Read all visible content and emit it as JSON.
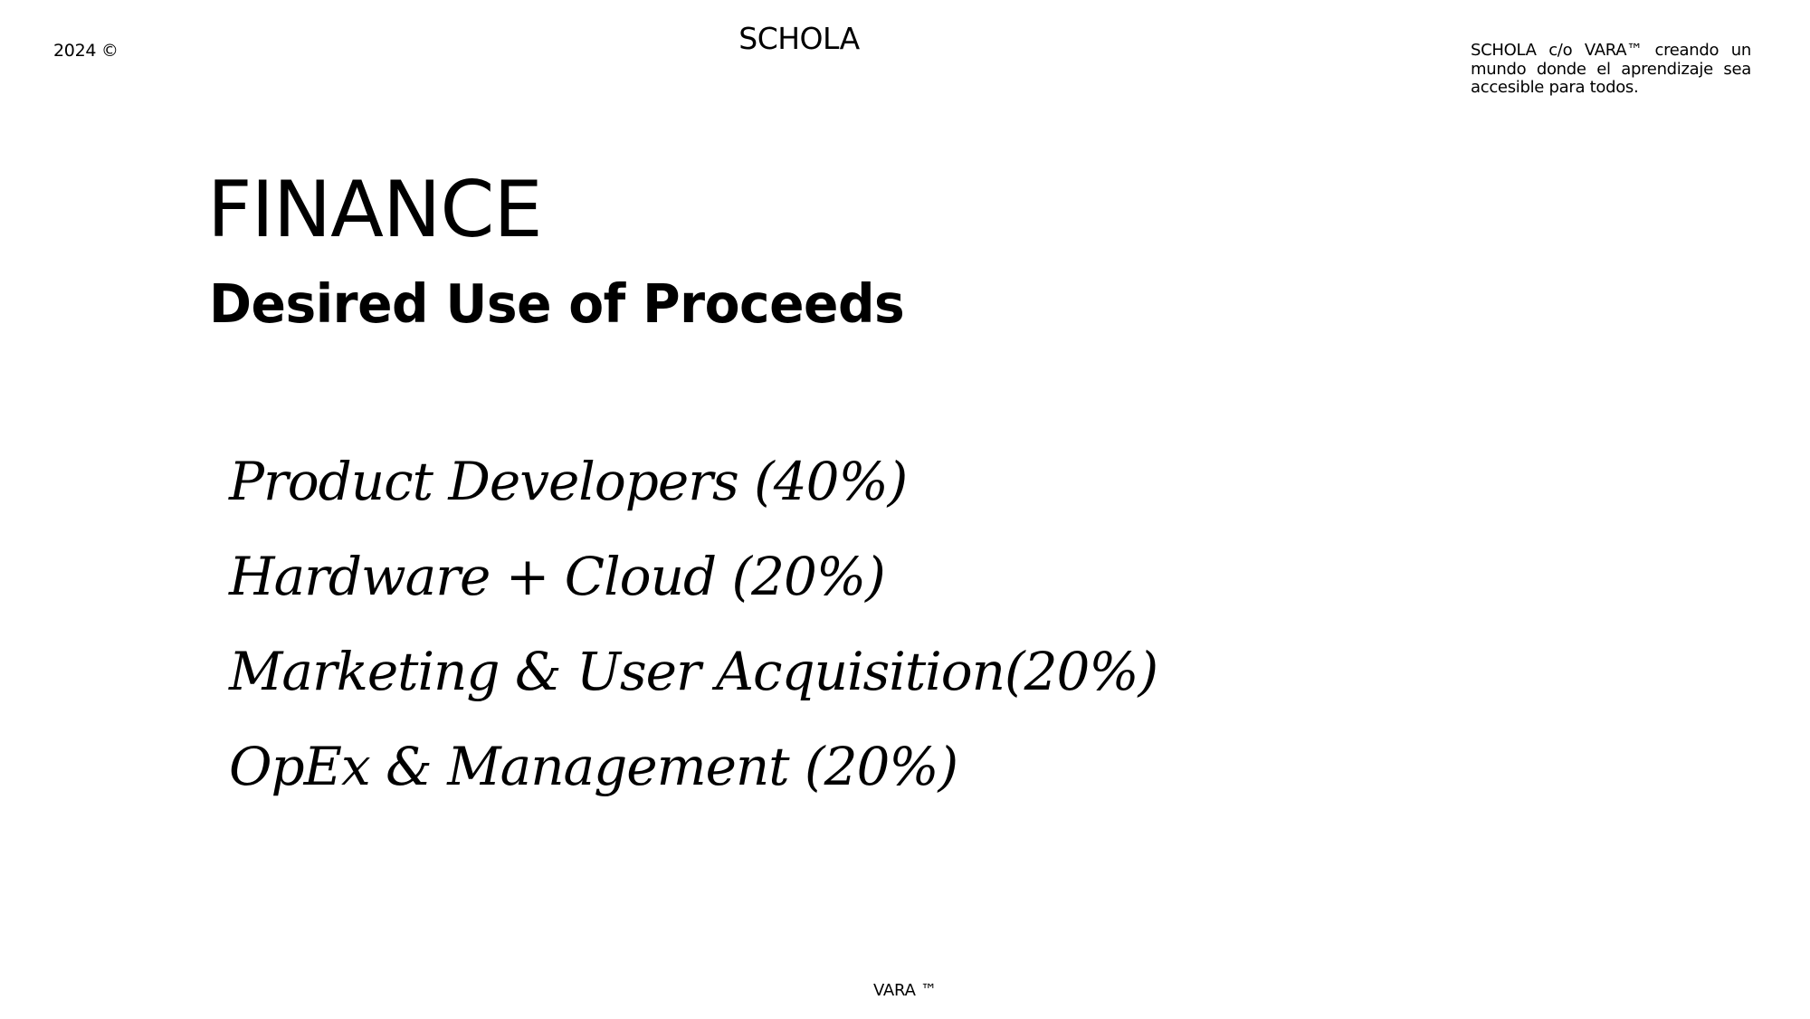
{
  "header": {
    "year": "2024 ©",
    "brand": "SCHOLA",
    "tagline": "SCHOLA c/o VARA™ creando un mundo donde el aprendizaje sea accesible para todos."
  },
  "slide": {
    "title": "FINANCE",
    "subtitle": "Desired Use of Proceeds",
    "items": [
      {
        "label": "Product Developers (40%)"
      },
      {
        "label": "Hardware + Cloud (20%)"
      },
      {
        "label": "Marketing & User Acquisition(20%)"
      },
      {
        "label": "OpEx & Management (20%)"
      }
    ]
  },
  "footer": {
    "text": "VARA ™"
  }
}
